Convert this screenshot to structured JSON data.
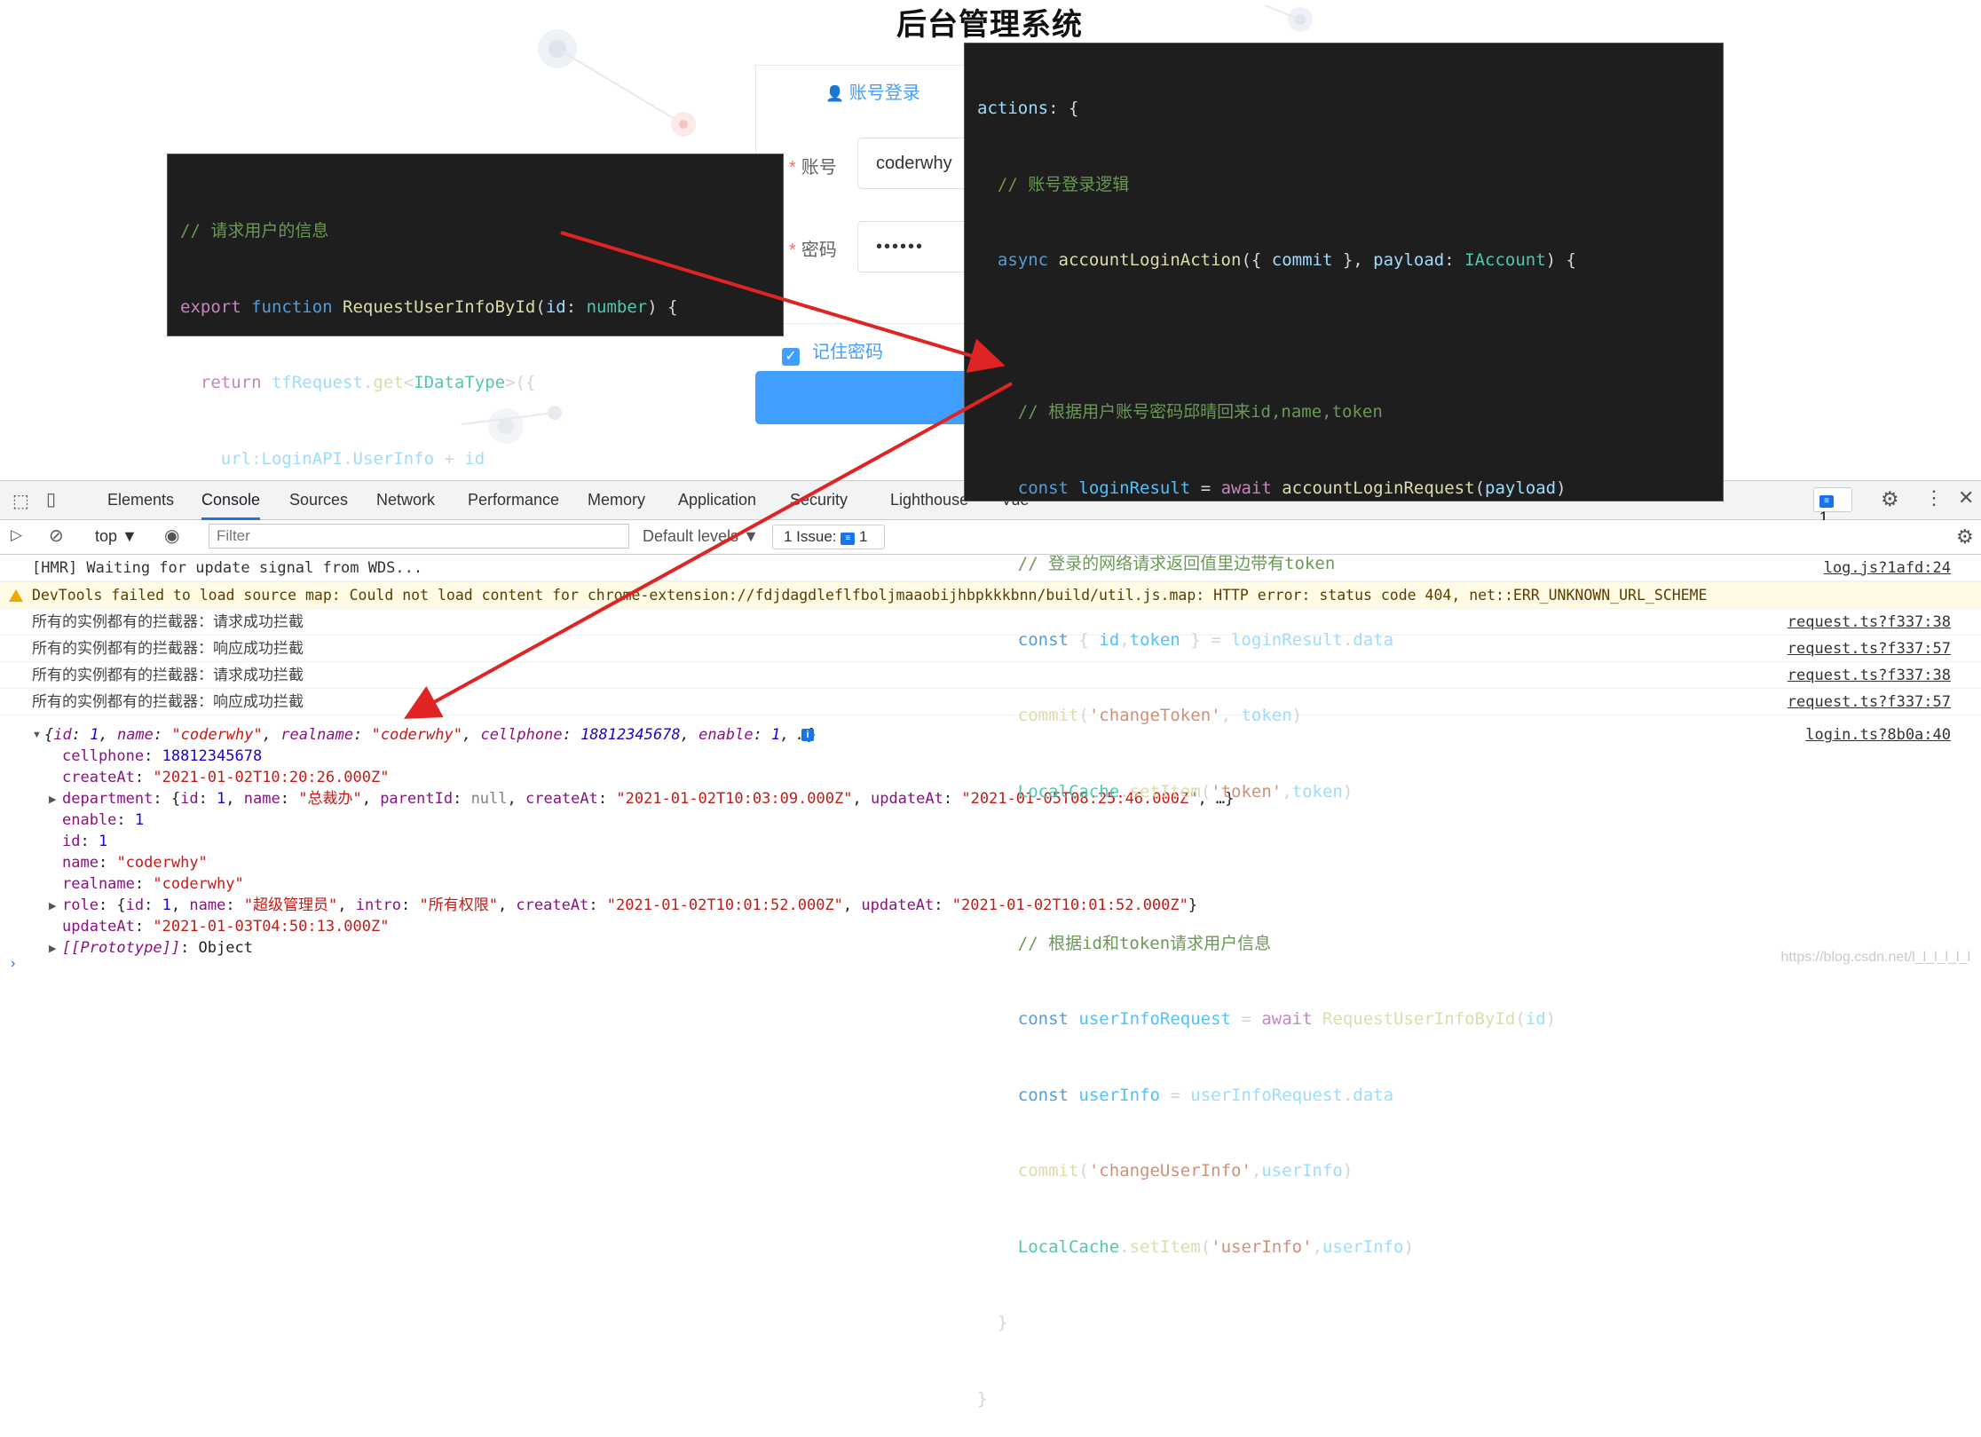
{
  "login": {
    "title": "后台管理系统",
    "tab_label": "账号登录",
    "account_label": "账号",
    "account_value": "coderwhy",
    "password_label": "密码",
    "password_value": "••••••",
    "remember_label": "记住密码"
  },
  "code_left": [
    "// 请求用户的信息",
    "export function RequestUserInfoById(id: number) {",
    "  return tfRequest.get<IDataType>({",
    "    url:LoginAPI.UserInfo + id",
    "  })",
    "}"
  ],
  "code_right": [
    "actions: {",
    "  // 账号登录逻辑",
    "  async accountLoginAction({ commit }, payload: IAccount) {",
    "",
    "    // 根据用户账号密码邱晴回来id,name,token",
    "    const loginResult = await accountLoginRequest(payload)",
    "    // 登录的网络请求返回值里边带有token",
    "    const { id,token } = loginResult.data",
    "    commit('changeToken', token)",
    "    LocalCache.setItem('token',token)",
    "",
    "    // 根据id和token请求用户信息",
    "    const userInfoRequest = await RequestUserInfoById(id)",
    "    const userInfo = userInfoRequest.data",
    "    commit('changeUserInfo',userInfo)",
    "    LocalCache.setItem('userInfo',userInfo)",
    "  }",
    "}"
  ],
  "devtools": {
    "tabs": [
      "Elements",
      "Console",
      "Sources",
      "Network",
      "Performance",
      "Memory",
      "Application",
      "Security",
      "Lighthouse",
      "Vue"
    ],
    "issues_top_count": "1",
    "context": "top",
    "filter_placeholder": "Filter",
    "levels": "Default levels",
    "issues_label": "1 Issue:",
    "issues_count": "1"
  },
  "console": {
    "lines": [
      {
        "text": "[HMR] Waiting for update signal from WDS...",
        "source": "log.js?1afd:24"
      },
      {
        "text": "DevTools failed to load source map: Could not load content for chrome-extension://fdjdagdleflfboljmaaobijhbpkkkbnn/build/util.js.map: HTTP error: status code 404, net::ERR_UNKNOWN_URL_SCHEME",
        "source": ""
      },
      {
        "text": "所有的实例都有的拦截器：请求成功拦截",
        "source": "request.ts?f337:38"
      },
      {
        "text": "所有的实例都有的拦截器：响应成功拦截",
        "source": "request.ts?f337:57"
      },
      {
        "text": "所有的实例都有的拦截器：请求成功拦截",
        "source": "request.ts?f337:38"
      },
      {
        "text": "所有的实例都有的拦截器：响应成功拦截",
        "source": "request.ts?f337:57"
      }
    ],
    "object_source": "login.ts?8b0a:40",
    "object": {
      "cellphone": "18812345678",
      "createAt": "\"2021-01-02T10:20:26.000Z\"",
      "enable": "1",
      "id": "1",
      "name": "\"coderwhy\"",
      "realname": "\"coderwhy\"",
      "updateAt": "\"2021-01-03T04:50:13.000Z\"",
      "prototype": "Object"
    }
  },
  "watermark": "https://blog.csdn.net/l_l_l_l_l_l"
}
